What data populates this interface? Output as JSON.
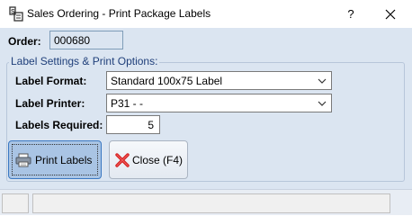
{
  "window": {
    "title": "Sales Ordering - Print Package Labels",
    "help_label": "?",
    "app_icon": "sales-ordering-icon",
    "close_icon": "close-icon"
  },
  "order": {
    "label": "Order:",
    "value": "000680"
  },
  "label_settings": {
    "legend": "Label Settings & Print Options:",
    "format_label": "Label Format:",
    "format_value": "Standard 100x75 Label",
    "printer_label": "Label Printer:",
    "printer_value": "P31 -  -",
    "required_label": "Labels Required:",
    "required_value": "5"
  },
  "buttons": {
    "print_label": "Print Labels",
    "print_icon": "printer-icon",
    "close_label": "Close (F4)",
    "close_icon": "red-x-icon"
  },
  "colors": {
    "client_background": "#dbe5f1",
    "legend_text": "#1f3f7a",
    "default_button": "#a9c4e4"
  }
}
